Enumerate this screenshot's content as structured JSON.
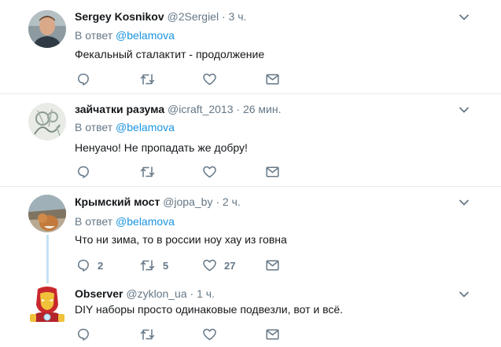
{
  "tweets": [
    {
      "name": "Sergey Kosnikov",
      "handle": "@2Sergiel",
      "dot": "·",
      "time": "3 ч.",
      "reply_prefix": "В ответ",
      "reply_mention": "@belamova",
      "text": "Фекальный сталактит - продолжение",
      "replies": "",
      "retweets": "",
      "likes": ""
    },
    {
      "name": "зайчатки разума",
      "handle": "@icraft_2013",
      "dot": "·",
      "time": "26 мин.",
      "reply_prefix": "В ответ",
      "reply_mention": "@belamova",
      "text": "Ненуачо! Не пропадать же добру!",
      "replies": "",
      "retweets": "",
      "likes": ""
    },
    {
      "name": "Крымский мост",
      "handle": "@jopa_by",
      "dot": "·",
      "time": "2 ч.",
      "reply_prefix": "В ответ",
      "reply_mention": "@belamova",
      "text": "Что ни зима, то в россии ноу хау из говна",
      "replies": "2",
      "retweets": "5",
      "likes": "27"
    },
    {
      "name": "Observer",
      "handle": "@zyklon_ua",
      "dot": "·",
      "time": "1 ч.",
      "text": "DIY наборы просто одинаковые подвезли, вот и всё.",
      "replies": "",
      "retweets": "",
      "likes": ""
    }
  ],
  "icons": {
    "reply": "reply-icon",
    "retweet": "retweet-icon",
    "like": "heart-icon",
    "dm": "envelope-icon",
    "caret": "chevron-down-icon"
  },
  "colors": {
    "name": "#14171a",
    "secondary": "#657786",
    "link": "#1b95e0",
    "thread_line": "#c4e1f3",
    "separator": "#e6ecf0"
  }
}
